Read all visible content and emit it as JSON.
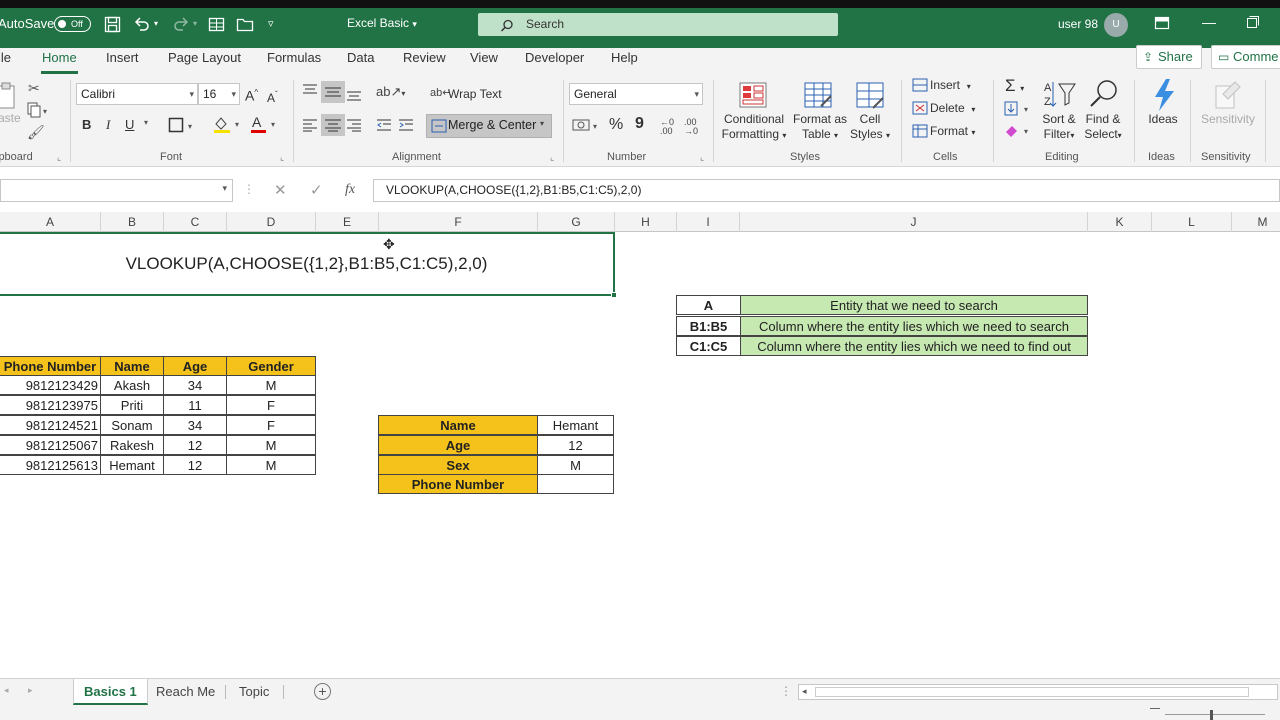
{
  "titlebar": {
    "autosave_label": "AutoSave",
    "autosave_state": "Off",
    "doc_title": "Excel Basic",
    "search_placeholder": "Search",
    "user_name": "user 98",
    "avatar_initial": "U"
  },
  "menu": {
    "tabs": [
      "ile",
      "Home",
      "Insert",
      "Page Layout",
      "Formulas",
      "Data",
      "Review",
      "View",
      "Developer",
      "Help"
    ],
    "active": "Home",
    "share_label": "Share",
    "comments_label": "Comme"
  },
  "ribbon": {
    "clipboard": {
      "paste_label": "aste",
      "group_label": "ipboard"
    },
    "font": {
      "name": "Calibri",
      "size": "16",
      "group_label": "Font",
      "bold": "B",
      "italic": "I",
      "underline": "U"
    },
    "alignment": {
      "wrap_text": "Wrap Text",
      "merge_center": "Merge & Center",
      "group_label": "Alignment"
    },
    "number": {
      "format": "General",
      "group_label": "Number"
    },
    "styles": {
      "conditional": [
        "Conditional",
        "Formatting"
      ],
      "format_table": [
        "Format as",
        "Table"
      ],
      "cell_styles": [
        "Cell",
        "Styles"
      ],
      "group_label": "Styles"
    },
    "cells": {
      "insert": "Insert",
      "delete": "Delete",
      "format": "Format",
      "group_label": "Cells"
    },
    "editing": {
      "sort_filter": [
        "Sort &",
        "Filter"
      ],
      "find_select": [
        "Find &",
        "Select"
      ],
      "group_label": "Editing"
    },
    "ideas": {
      "label": "Ideas",
      "group_label": "Ideas"
    },
    "sensitivity": {
      "label": "Sensitivity",
      "group_label": "Sensitivity"
    }
  },
  "formula_bar": {
    "fx": "fx",
    "formula": "VLOOKUP(A,CHOOSE({1,2},B1:B5,C1:C5),2,0)"
  },
  "columns": [
    "A",
    "B",
    "C",
    "D",
    "E",
    "F",
    "G",
    "H",
    "I",
    "J",
    "K",
    "L",
    "M"
  ],
  "merged_cell_text": "VLOOKUP(A,CHOOSE({1,2},B1:B5,C1:C5),2,0)",
  "main_table": {
    "headers": [
      "Phone Number",
      "Name",
      "Age",
      "Gender"
    ],
    "rows": [
      [
        "9812123429",
        "Akash",
        "34",
        "M"
      ],
      [
        "9812123975",
        "Priti",
        "11",
        "F"
      ],
      [
        "9812124521",
        "Sonam",
        "34",
        "F"
      ],
      [
        "9812125067",
        "Rakesh",
        "12",
        "M"
      ],
      [
        "9812125613",
        "Hemant",
        "12",
        "M"
      ]
    ]
  },
  "lookup_table": {
    "rows": [
      [
        "Name",
        "Hemant"
      ],
      [
        "Age",
        "12"
      ],
      [
        "Sex",
        "M"
      ],
      [
        "Phone Number",
        ""
      ]
    ]
  },
  "legend_table": {
    "rows": [
      [
        "A",
        "Entity that we need to search"
      ],
      [
        "B1:B5",
        "Column where the entity lies which we need to search"
      ],
      [
        "C1:C5",
        "Column where the entity lies which we need to find out"
      ]
    ]
  },
  "sheets": {
    "tabs": [
      "Basics 1",
      "Reach Me",
      "Topic"
    ],
    "active": "Basics 1"
  },
  "colors": {
    "accent": "#217346",
    "header_fill": "#f5c21b",
    "legend_fill": "#c6e8b1"
  }
}
